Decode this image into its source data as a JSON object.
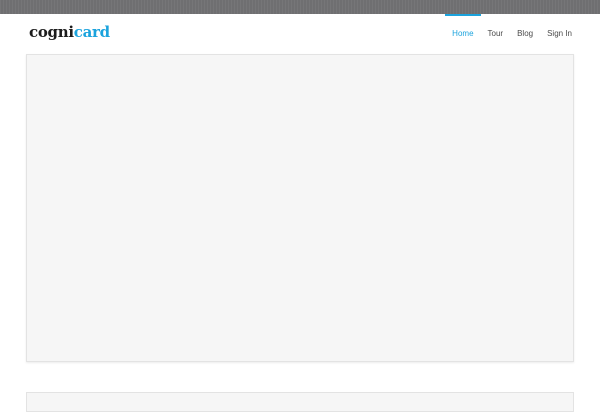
{
  "header": {
    "logo": {
      "part1": "cogni",
      "part2": "card"
    },
    "nav": [
      {
        "label": "Home",
        "active": true
      },
      {
        "label": "Tour",
        "active": false
      },
      {
        "label": "Blog",
        "active": false
      },
      {
        "label": "Sign In",
        "active": false
      }
    ]
  },
  "colors": {
    "accent": "#1ba3dd",
    "topbar": "#6f6f71",
    "panel": "#f6f6f6"
  }
}
